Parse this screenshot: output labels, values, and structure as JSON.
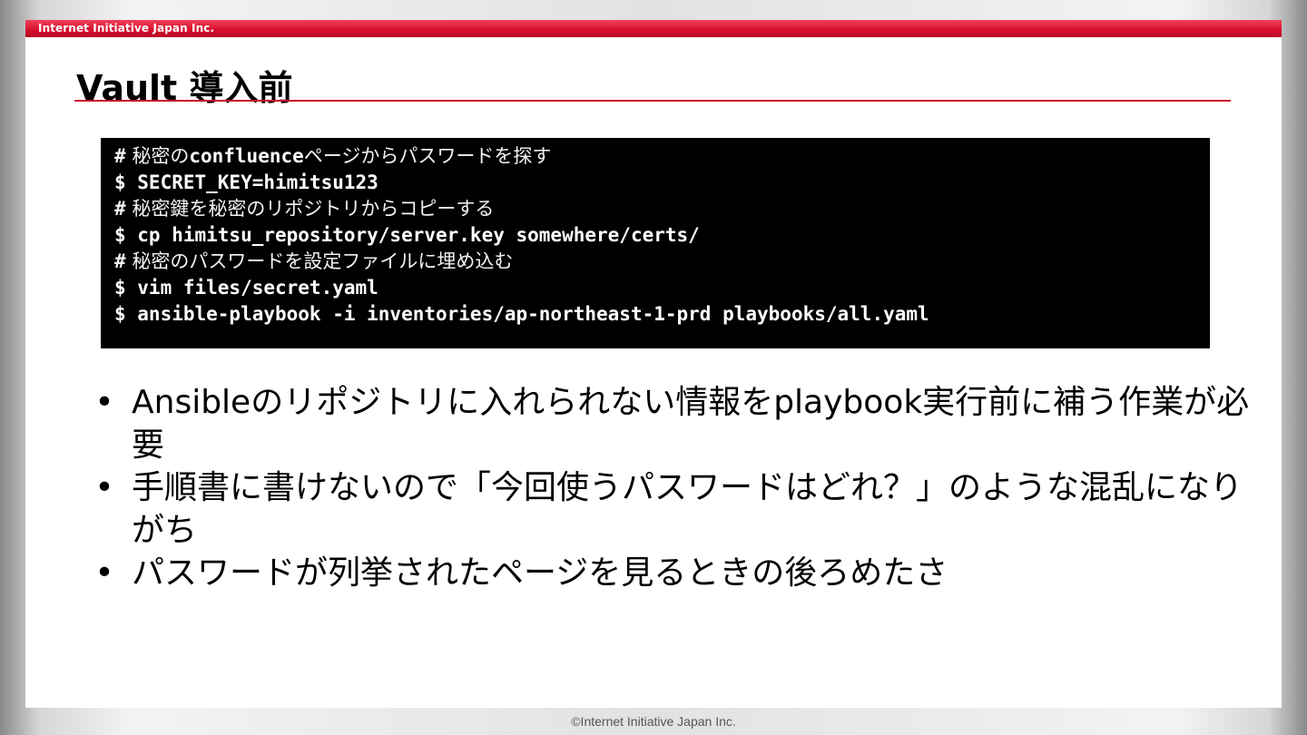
{
  "header": {
    "company": "Internet Initiative Japan Inc."
  },
  "slide": {
    "title": "Vault 導入前"
  },
  "terminal": {
    "lines": [
      {
        "kind": "comment",
        "prefix": "#",
        "pre": " 秘密の",
        "mono": "confluence",
        "post": "ページからパスワードを探す"
      },
      {
        "kind": "cmd",
        "text": "$ SECRET_KEY=himitsu123"
      },
      {
        "kind": "comment",
        "prefix": "#",
        "pre": " 秘密鍵を秘密のリポジトリからコピーする"
      },
      {
        "kind": "cmd",
        "text": "$ cp himitsu_repository/server.key somewhere/certs/"
      },
      {
        "kind": "comment",
        "prefix": "#",
        "pre": " 秘密のパスワードを設定ファイルに埋め込む"
      },
      {
        "kind": "cmd",
        "text": "$ vim files/secret.yaml"
      },
      {
        "kind": "cmd",
        "text": "$ ansible-playbook -i inventories/ap-northeast-1-prd playbooks/all.yaml"
      }
    ]
  },
  "bullets": {
    "symbol": "•",
    "items": [
      "Ansibleのリポジトリに入れられない情報をplaybook実行前に補う作業が必要",
      "手順書に書けないので「今回使うパスワードはどれ？」のような混乱になりがち",
      "パスワードが列挙されたページを見るときの後ろめたさ"
    ]
  },
  "footer": {
    "copyright": "©Internet Initiative Japan Inc."
  }
}
